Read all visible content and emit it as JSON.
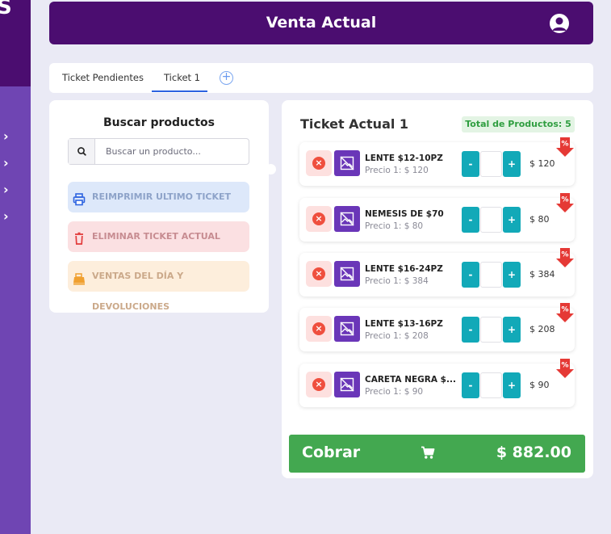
{
  "sidebar": {
    "logo_char": "S",
    "chevron_glyph": "›",
    "chevrons": 4
  },
  "header": {
    "title": "Venta Actual",
    "user_icon": "user-circle-icon"
  },
  "tabs": {
    "items": [
      {
        "label": "Ticket Pendientes",
        "active": false
      },
      {
        "label": "Ticket 1",
        "active": true
      }
    ],
    "add_glyph": "+"
  },
  "search_panel": {
    "title": "Buscar productos",
    "search_placeholder": "Buscar un producto...",
    "buttons": {
      "reprint": "REIMPRIMIR ULTIMO TICKET",
      "delete": "ELIMINAR TICKET ACTUAL",
      "sales": "VENTAS DEL DÍA Y DEVOLUCIONES"
    }
  },
  "ticket": {
    "title": "Ticket Actual 1",
    "total_products_label": "Total de Productos: 5",
    "remove_glyph": "×",
    "minus_label": "-",
    "plus_label": "+",
    "discount_glyph": "%",
    "items": [
      {
        "name": "LENTE $12-10PZ",
        "price": "Precio 1: $ 120",
        "total": "$ 120"
      },
      {
        "name": "NEMESIS DE $70",
        "price": "Precio 1: $ 80",
        "total": "$ 80"
      },
      {
        "name": "LENTE $16-24PZ",
        "price": "Precio 1: $ 384",
        "total": "$ 384"
      },
      {
        "name": "LENTE $13-16PZ",
        "price": "Precio 1: $ 208",
        "total": "$ 208"
      },
      {
        "name": "CARETA NEGRA $...",
        "price": "Precio 1: $ 90",
        "total": "$ 90"
      }
    ],
    "checkout": {
      "label": "Cobrar",
      "total": "$ 882.00"
    }
  },
  "colors": {
    "brand_purple": "#4b0d70",
    "sidebar_purple": "#6f45b3",
    "teal": "#12a9b8",
    "green": "#43a850",
    "red": "#ef4f3e"
  }
}
